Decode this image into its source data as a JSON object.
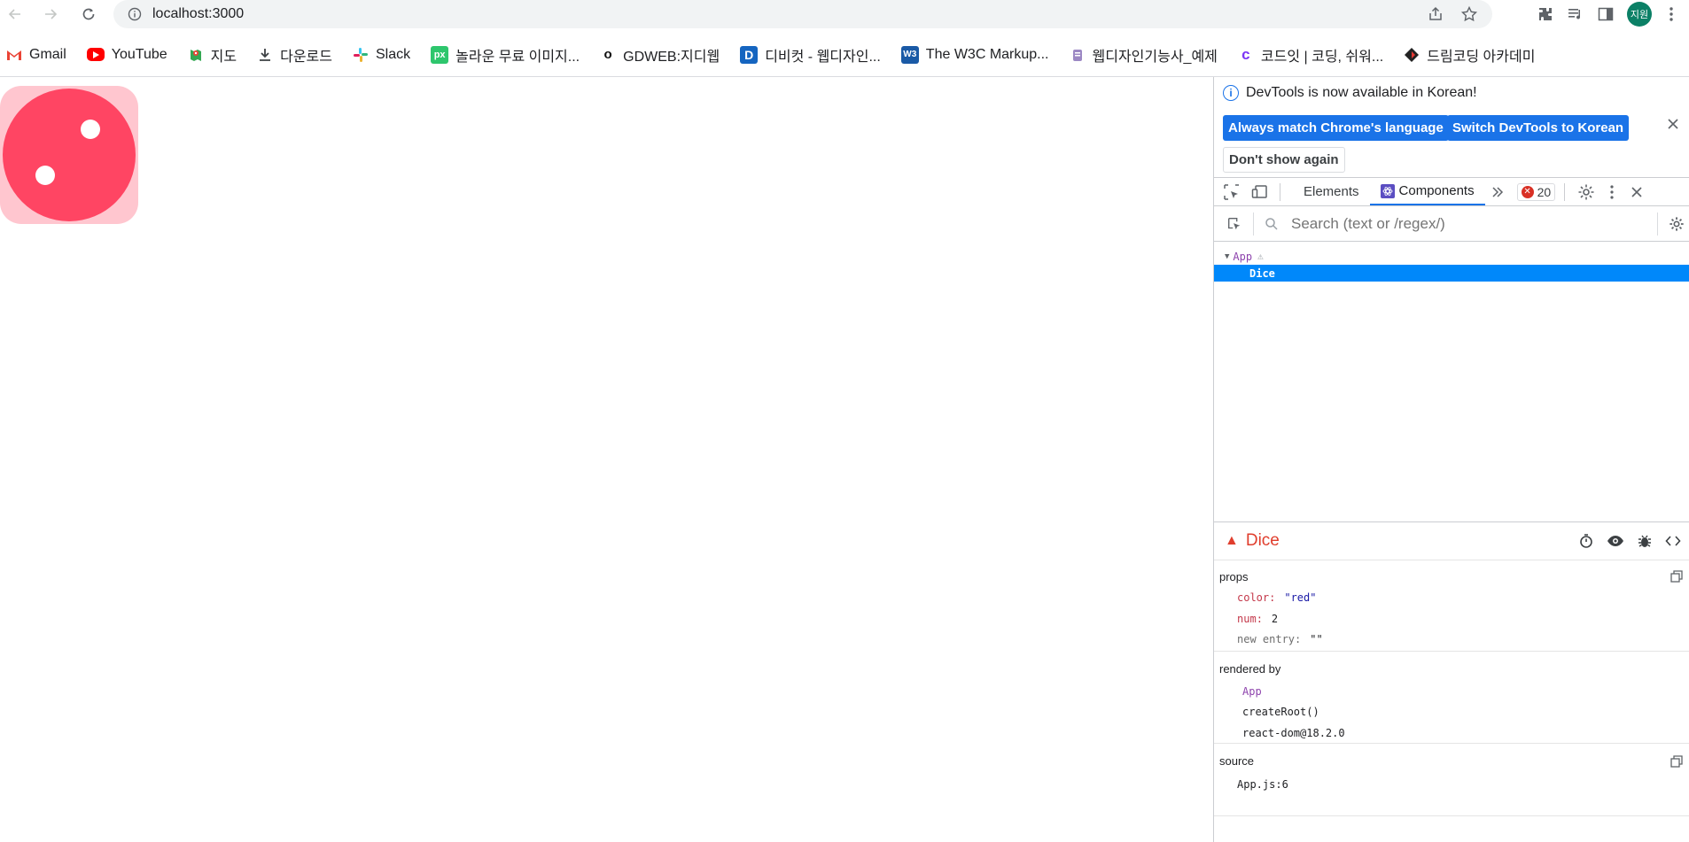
{
  "browser": {
    "url": "localhost:3000",
    "avatar_label": "지원",
    "bookmarks": [
      {
        "label": "Gmail",
        "icon": "gmail-icon"
      },
      {
        "label": "YouTube",
        "icon": "youtube-icon"
      },
      {
        "label": "지도",
        "icon": "maps-icon"
      },
      {
        "label": "다운로드",
        "icon": "download-icon"
      },
      {
        "label": "Slack",
        "icon": "slack-icon"
      },
      {
        "label": "놀라운 무료 이미지...",
        "icon": "pixabay-icon"
      },
      {
        "label": "GDWEB:지디웹",
        "icon": "gdweb-icon"
      },
      {
        "label": "디비컷 - 웹디자인...",
        "icon": "dbcut-icon"
      },
      {
        "label": "The W3C Markup...",
        "icon": "w3c-icon"
      },
      {
        "label": "웹디자인기능사_예제",
        "icon": "doc-icon"
      },
      {
        "label": "코드잇 | 코딩, 쉬워...",
        "icon": "codeit-icon"
      },
      {
        "label": "드림코딩 아카데미",
        "icon": "dreamcoding-icon"
      }
    ]
  },
  "page": {
    "dice": {
      "color": "#ff4563",
      "bg_color": "#ffc6cf",
      "num": 2
    }
  },
  "devtools": {
    "infobar": {
      "message": "DevTools is now available in Korean!",
      "btn_match": "Always match Chrome's language",
      "btn_switch": "Switch DevTools to Korean",
      "btn_dont_show": "Don't show again"
    },
    "tabs": {
      "elements": "Elements",
      "components": "Components",
      "error_count": "20"
    },
    "search_placeholder": "Search (text or /regex/)",
    "tree": {
      "root": "App",
      "child": "Dice"
    },
    "inspector": {
      "component_name": "Dice",
      "props_title": "props",
      "props": [
        {
          "key": "color",
          "value": "\"red\""
        },
        {
          "key": "num",
          "value": "2"
        },
        {
          "key": "new entry",
          "value": "\"\""
        }
      ],
      "rendered_by_title": "rendered by",
      "rendered_by": [
        "App",
        "createRoot()",
        "react-dom@18.2.0"
      ],
      "source_title": "source",
      "source": "App.js:6"
    },
    "colors": {
      "accent": "#1a73e8",
      "selected_row": "#0088fa",
      "warning": "#e03e2d"
    }
  }
}
